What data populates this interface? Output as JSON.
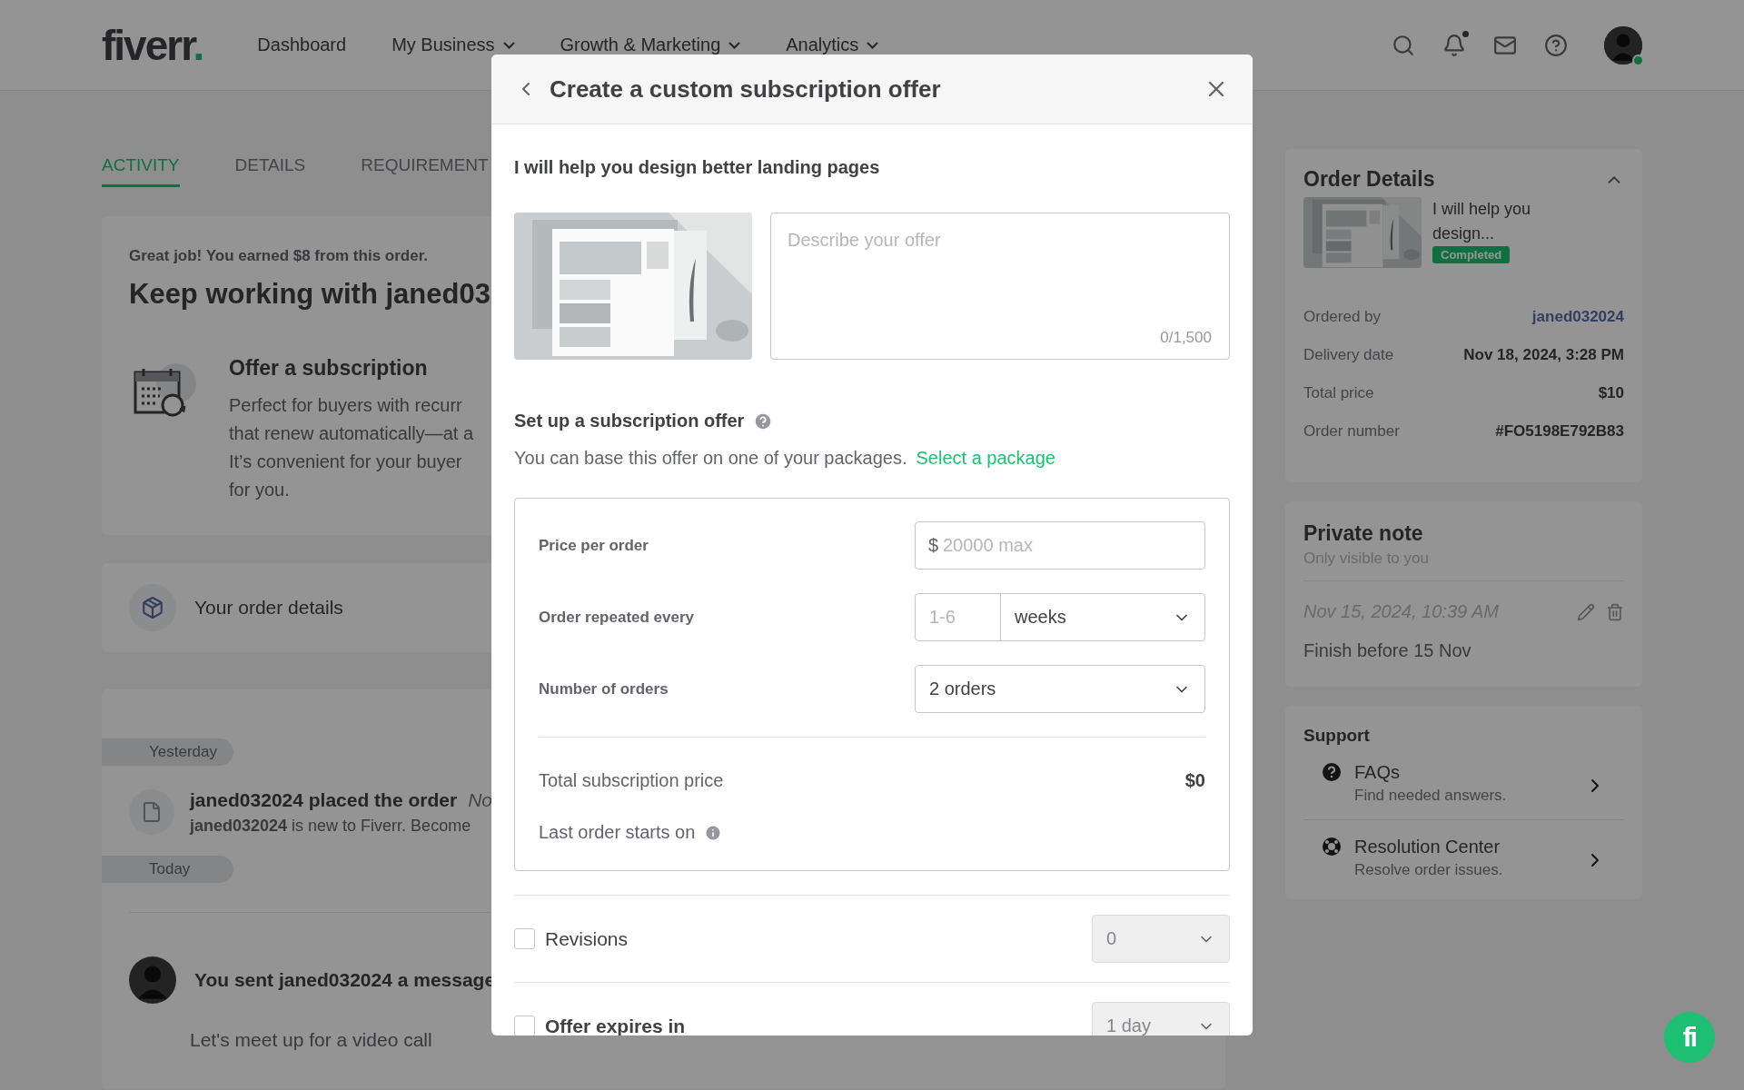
{
  "header": {
    "logo": "fiverr",
    "logo_mark": ".",
    "nav": [
      {
        "label": "Dashboard",
        "has_menu": false
      },
      {
        "label": "My Business",
        "has_menu": true
      },
      {
        "label": "Growth & Marketing",
        "has_menu": true
      },
      {
        "label": "Analytics",
        "has_menu": true
      }
    ],
    "bell_dot": true,
    "online": true
  },
  "tabs": [
    {
      "label": "ACTIVITY",
      "selected": true
    },
    {
      "label": "DETAILS",
      "selected": false
    },
    {
      "label": "REQUIREMENT",
      "selected": false
    }
  ],
  "earned_card": {
    "note": "Great job! You earned $8 from this order.",
    "title": "Keep working with janed03",
    "offer_title": "Offer a subscription",
    "offer_lines": [
      "Perfect for buyers with recurr",
      "that renew automatically—at a",
      "It’s convenient for your buyer",
      "for you."
    ]
  },
  "order_details_link": {
    "label": "Your order details"
  },
  "timeline": [
    {
      "kind": "date",
      "label": "Yesterday"
    },
    {
      "kind": "event",
      "title": "janed032024 placed the order",
      "time": "No",
      "text": "**janed032024** is new to Fiverr. Become"
    },
    {
      "kind": "date",
      "label": "Today"
    },
    {
      "kind": "message",
      "title": "You sent janed032024 a message",
      "text": "Let's meet up for a video call"
    }
  ],
  "modal": {
    "title": "Create a custom subscription offer",
    "gig_title": "I will help you design better landing pages",
    "description": {
      "placeholder": "Describe your offer",
      "counter": "0/1,500"
    },
    "section_title": "Set up a subscription offer",
    "section_text": "You can base this offer on one of your packages.",
    "package_link": "Select a package",
    "fields": [
      {
        "kind": "price",
        "label": "Price per order",
        "prefix": "$",
        "placeholder": "20000 max"
      },
      {
        "kind": "repeat",
        "label": "Order repeated every",
        "placeholder": "1-6",
        "unit": "weeks"
      },
      {
        "kind": "select",
        "label": "Number of orders",
        "value": "2 orders"
      }
    ],
    "total": {
      "label": "Total subscription price",
      "value": "$0"
    },
    "last_order": {
      "label": "Last order starts on"
    },
    "options": [
      {
        "label": "Revisions",
        "strong": false,
        "checked": false,
        "value": "0",
        "disabled": true
      },
      {
        "label": "Offer expires in",
        "strong": true,
        "checked": false,
        "value": "1 day",
        "disabled": true
      }
    ]
  },
  "sidebar": {
    "order_details": {
      "title": "Order Details",
      "expanded": true,
      "gig_title": "I will help you design...",
      "status": "Completed",
      "rows": [
        {
          "label": "Ordered by",
          "value": "janed032024",
          "kind": "link"
        },
        {
          "label": "Delivery date",
          "value": "Nov 18, 2024, 3:28 PM",
          "kind": "text"
        },
        {
          "label": "Total price",
          "value": "$10",
          "kind": "text"
        },
        {
          "label": "Order number",
          "value": "#FO5198E792B83",
          "kind": "text"
        }
      ]
    },
    "private_note": {
      "title": "Private note",
      "subtitle": "Only visible to you",
      "date": "Nov 15, 2024, 10:39 AM",
      "text": "Finish before 15 Nov"
    },
    "support": {
      "title": "Support",
      "items": [
        {
          "kind": "faq",
          "title": "FAQs",
          "subtitle": "Find needed answers."
        },
        {
          "kind": "resolution",
          "title": "Resolution Center",
          "subtitle": "Resolve order issues."
        }
      ]
    }
  },
  "chat_button": {
    "label": "fi"
  }
}
